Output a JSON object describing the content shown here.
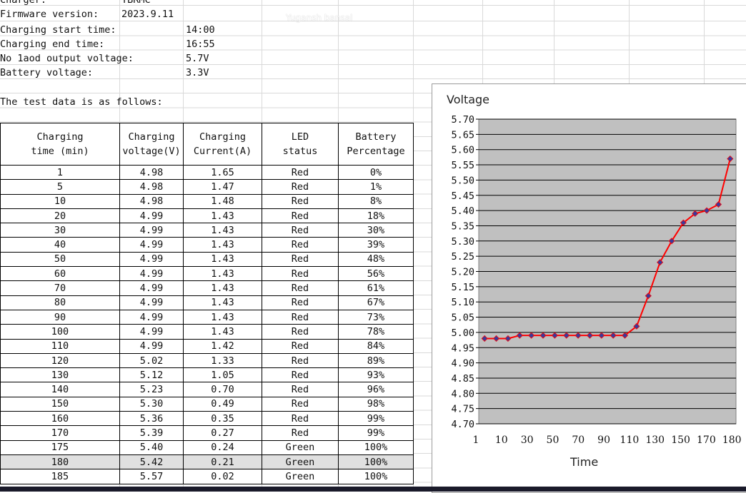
{
  "info": {
    "charger_label": "Charger:",
    "charger_value": "TBRMC",
    "firmware_label": "Firmware version:",
    "firmware_value": "2023.9.11",
    "start_label": "Charging start time:",
    "start_value": "14:00",
    "end_label": "Charging end time:",
    "end_value": "16:55",
    "noload_label": "No 1aod output voltage:",
    "noload_value": "5.7V",
    "battery_label": "Battery voltage:",
    "battery_value": "3.3V",
    "intro": "The test data is as follows:"
  },
  "watermark": "Yugansh bansal",
  "table": {
    "headers": [
      [
        "Charging",
        "time (min)"
      ],
      [
        "Charging",
        "voltage(V)"
      ],
      [
        "Charging",
        "Current(A)"
      ],
      [
        "LED",
        "status"
      ],
      [
        "Battery",
        "Percentage"
      ]
    ],
    "rows": [
      [
        "1",
        "4.98",
        "1.65",
        "Red",
        "0%"
      ],
      [
        "5",
        "4.98",
        "1.47",
        "Red",
        "1%"
      ],
      [
        "10",
        "4.98",
        "1.48",
        "Red",
        "8%"
      ],
      [
        "20",
        "4.99",
        "1.43",
        "Red",
        "18%"
      ],
      [
        "30",
        "4.99",
        "1.43",
        "Red",
        "30%"
      ],
      [
        "40",
        "4.99",
        "1.43",
        "Red",
        "39%"
      ],
      [
        "50",
        "4.99",
        "1.43",
        "Red",
        "48%"
      ],
      [
        "60",
        "4.99",
        "1.43",
        "Red",
        "56%"
      ],
      [
        "70",
        "4.99",
        "1.43",
        "Red",
        "61%"
      ],
      [
        "80",
        "4.99",
        "1.43",
        "Red",
        "67%"
      ],
      [
        "90",
        "4.99",
        "1.43",
        "Red",
        "73%"
      ],
      [
        "100",
        "4.99",
        "1.43",
        "Red",
        "78%"
      ],
      [
        "110",
        "4.99",
        "1.42",
        "Red",
        "84%"
      ],
      [
        "120",
        "5.02",
        "1.33",
        "Red",
        "89%"
      ],
      [
        "130",
        "5.12",
        "1.05",
        "Red",
        "93%"
      ],
      [
        "140",
        "5.23",
        "0.70",
        "Red",
        "96%"
      ],
      [
        "150",
        "5.30",
        "0.49",
        "Red",
        "98%"
      ],
      [
        "160",
        "5.36",
        "0.35",
        "Red",
        "99%"
      ],
      [
        "170",
        "5.39",
        "0.27",
        "Red",
        "99%"
      ],
      [
        "175",
        "5.40",
        "0.24",
        "Green",
        "100%"
      ],
      [
        "180",
        "5.42",
        "0.21",
        "Green",
        "100%"
      ],
      [
        "185",
        "5.57",
        "0.02",
        "Green",
        "100%"
      ]
    ]
  },
  "chart_data": {
    "type": "line",
    "title": "Voltage",
    "xlabel": "Time",
    "ylabel": "",
    "x": [
      "1",
      "5",
      "10",
      "20",
      "30",
      "40",
      "50",
      "60",
      "70",
      "80",
      "90",
      "100",
      "110",
      "120",
      "130",
      "140",
      "150",
      "160",
      "170",
      "175",
      "180",
      "185"
    ],
    "x_tick_labels": [
      "1",
      "10",
      "30",
      "50",
      "70",
      "90",
      "110",
      "130",
      "150",
      "170",
      "180"
    ],
    "series": [
      {
        "values": [
          4.98,
          4.98,
          4.98,
          4.99,
          4.99,
          4.99,
          4.99,
          4.99,
          4.99,
          4.99,
          4.99,
          4.99,
          4.99,
          5.02,
          5.12,
          5.23,
          5.3,
          5.36,
          5.39,
          5.4,
          5.42,
          5.57
        ]
      }
    ],
    "ylim": [
      4.7,
      5.7
    ],
    "y_ticks": [
      "4.70",
      "4.75",
      "4.80",
      "4.85",
      "4.90",
      "4.95",
      "5.00",
      "5.05",
      "5.10",
      "5.15",
      "5.20",
      "5.25",
      "5.30",
      "5.35",
      "5.40",
      "5.45",
      "5.50",
      "5.55",
      "5.60",
      "5.65",
      "5.70"
    ],
    "grid": true,
    "line_color": "#ff0000",
    "marker_color": "#3a3a9a",
    "plot_bg": "#c0c0c0"
  }
}
